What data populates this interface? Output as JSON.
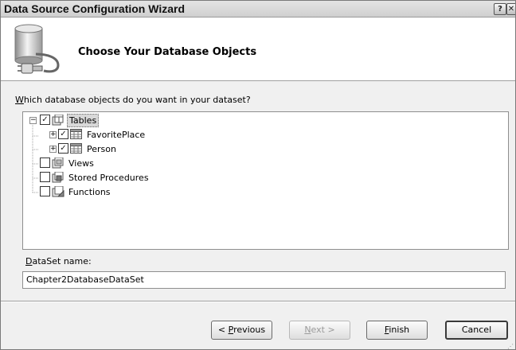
{
  "window": {
    "title": "Data Source Configuration Wizard",
    "help_glyph": "?",
    "close_glyph": "✕"
  },
  "header": {
    "title": "Choose Your Database Objects",
    "icon": "database-connection-icon"
  },
  "prompt": {
    "mnemonic": "W",
    "rest": "hich database objects do you want in your dataset?"
  },
  "tree": {
    "nodes": [
      {
        "label": "Tables",
        "checked": true,
        "expander": "minus",
        "icon": "tables-folder-icon",
        "selected": true
      },
      {
        "label": "FavoritePlace",
        "checked": true,
        "expander": "plus",
        "icon": "table-grid-icon"
      },
      {
        "label": "Person",
        "checked": true,
        "expander": "plus",
        "icon": "table-grid-icon"
      },
      {
        "label": "Views",
        "checked": false,
        "icon": "views-folder-icon"
      },
      {
        "label": "Stored Procedures",
        "checked": false,
        "icon": "procedures-folder-icon"
      },
      {
        "label": "Functions",
        "checked": false,
        "icon": "functions-folder-icon"
      }
    ],
    "check_glyph": "✓",
    "plus_glyph": "+",
    "minus_glyph": "−"
  },
  "dataset": {
    "mnemonic": "D",
    "label_rest": "ataSet name:",
    "value": "Chapter2DatabaseDataSet"
  },
  "buttons": {
    "previous": {
      "prefix": "< ",
      "mnemonic": "P",
      "rest": "revious"
    },
    "next": {
      "mnemonic": "N",
      "rest": "ext >",
      "disabled": true
    },
    "finish": {
      "mnemonic": "F",
      "rest": "inish"
    },
    "cancel": {
      "label": "Cancel"
    }
  }
}
